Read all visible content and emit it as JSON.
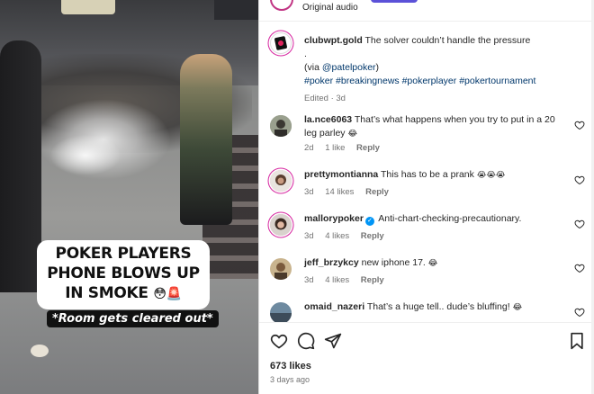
{
  "video": {
    "caption_line1": "POKER PLAYERS",
    "caption_line2": "PHONE BLOWS UP",
    "caption_line3": "IN SMOKE",
    "caption_emoji": "😳🚨",
    "subcaption": "*Room gets cleared out*"
  },
  "header": {
    "audio_label": "Original audio"
  },
  "post": {
    "username": "clubwpt.gold",
    "text": "The solver couldn’t handle the pressure",
    "dot": ".",
    "via_prefix": "(via ",
    "via_handle": "@patelpoker",
    "via_suffix": ")",
    "hashtags": "#poker #breakingnews #pokerplayer #pokertournament",
    "edited": "Edited · 3d"
  },
  "comments": [
    {
      "username": "la.nce6063",
      "text": "That’s what happens when you try to put in a 20 leg parley",
      "emoji": "😂",
      "age": "2d",
      "likes": "1 like",
      "reply": "Reply",
      "verified": false
    },
    {
      "username": "prettymontianna",
      "text": "This has to be a prank",
      "emoji": "😭😭😭",
      "age": "3d",
      "likes": "14 likes",
      "reply": "Reply",
      "verified": false
    },
    {
      "username": "mallorypoker",
      "text": "Anti-chart-checking-precautionary.",
      "emoji": "",
      "age": "3d",
      "likes": "4 likes",
      "reply": "Reply",
      "verified": true
    },
    {
      "username": "jeff_brzykcy",
      "text": "new iphone 17.",
      "emoji": "😂",
      "age": "3d",
      "likes": "4 likes",
      "reply": "Reply",
      "verified": false
    },
    {
      "username": "omaid_nazeri",
      "text": "That’s a huge tell.. dude’s bluffing!",
      "emoji": "😂",
      "age": "",
      "likes": "",
      "reply": "",
      "verified": false
    }
  ],
  "footer": {
    "likes": "673 likes",
    "time": "3 days ago"
  },
  "icons": [
    "heart-icon",
    "comment-icon",
    "share-icon",
    "save-icon"
  ],
  "colors": {
    "link": "#00376b",
    "verified": "#0095f6",
    "muted": "#737373"
  }
}
